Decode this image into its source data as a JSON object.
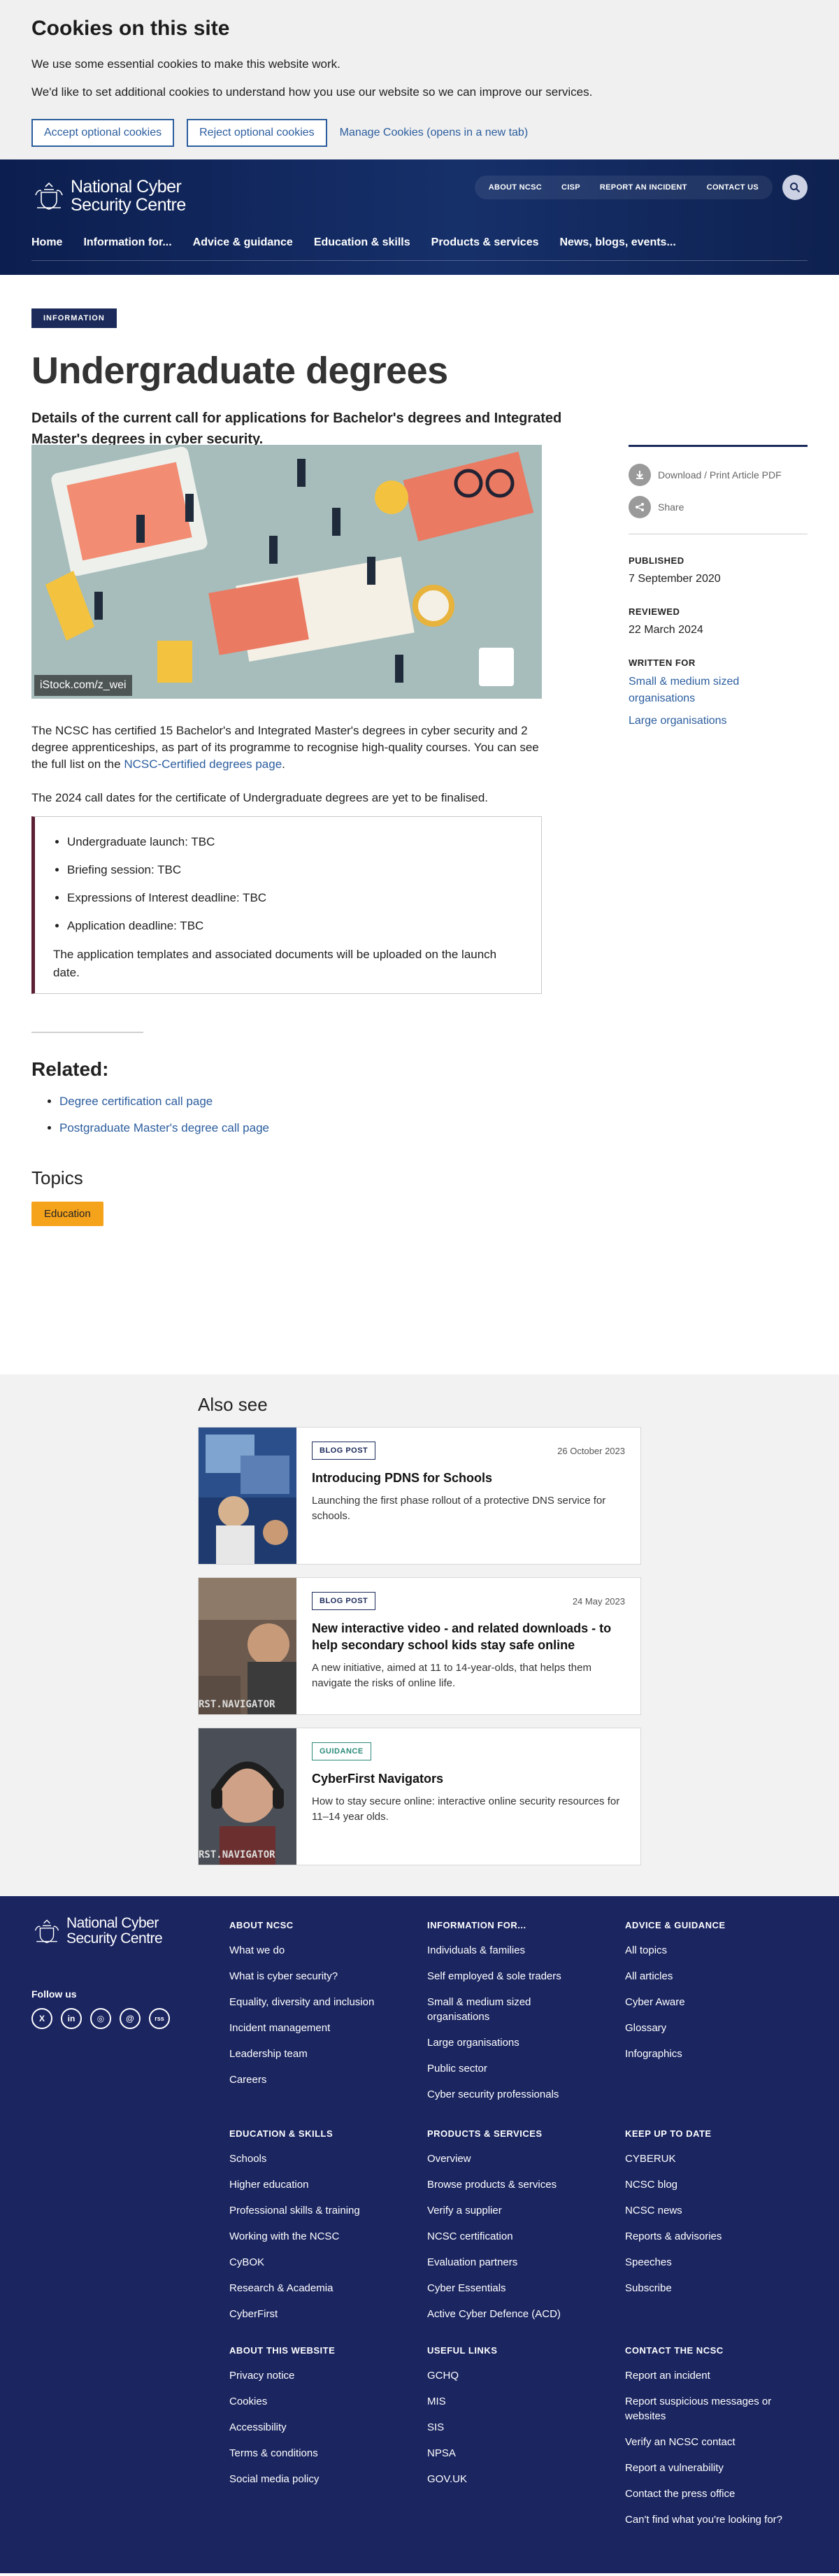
{
  "cookie": {
    "title": "Cookies on this site",
    "line1": "We use some essential cookies to make this website work.",
    "line2": "We'd like to set additional cookies to understand how you use our website so we can improve our services.",
    "accept": "Accept optional cookies",
    "reject": "Reject optional cookies",
    "manage": "Manage Cookies (opens in a new tab)"
  },
  "header": {
    "logo_line1": "National Cyber",
    "logo_line2": "Security Centre",
    "util": [
      "ABOUT NCSC",
      "CISP",
      "REPORT AN INCIDENT",
      "CONTACT US"
    ],
    "nav": [
      "Home",
      "Information for...",
      "Advice & guidance",
      "Education & skills",
      "Products & services",
      "News, blogs, events..."
    ]
  },
  "article": {
    "badge": "INFORMATION",
    "title": "Undergraduate degrees",
    "lede": "Details of the current call for applications for Bachelor's degrees and Integrated Master's degrees in cyber security.",
    "image_credit": "iStock.com/z_wei",
    "p1_before": "The NCSC has certified 15 Bachelor's and Integrated Master's degrees in cyber security and 2 degree apprenticeships, as part of its programme to recognise high-quality courses. You can see the full list on the ",
    "p1_link": "NCSC-Certified degrees page",
    "p1_after": ".",
    "p2": "The 2024 call dates for the certificate of Undergraduate degrees are yet to be finalised.",
    "callout_items": [
      "Undergraduate launch: TBC",
      "Briefing session: TBC",
      "Expressions of Interest deadline: TBC",
      "Application deadline: TBC"
    ],
    "callout_note": "The application templates and associated documents will be uploaded on the launch date.",
    "related_title": "Related:",
    "related_links": [
      "Degree certification call page",
      "Postgraduate Master's degree call page"
    ],
    "topics_title": "Topics",
    "topic_tag": "Education"
  },
  "sidebar": {
    "download": "Download / Print Article PDF",
    "share": "Share",
    "published_label": "PUBLISHED",
    "published": "7 September 2020",
    "reviewed_label": "REVIEWED",
    "reviewed": "22 March 2024",
    "written_label": "WRITTEN FOR",
    "written": [
      "Small & medium sized organisations",
      "Large organisations"
    ]
  },
  "also_see": {
    "title": "Also see",
    "cards": [
      {
        "tag": "BLOG POST",
        "date": "26 October 2023",
        "title": "Introducing PDNS for Schools",
        "desc": "Launching the first phase rollout of a protective DNS service for schools.",
        "img_text": ""
      },
      {
        "tag": "BLOG POST",
        "date": "24 May 2023",
        "title": "New interactive video - and related downloads - to help secondary school kids stay safe online",
        "desc": "A new initiative, aimed at 11 to 14-year-olds, that helps them navigate the risks of online life.",
        "img_text": "RST.NAVIGATOR"
      },
      {
        "tag": "GUIDANCE",
        "date": "",
        "title": "CyberFirst Navigators",
        "desc": "How to stay secure online: interactive online security resources for 11–14 year olds.",
        "img_text": "RST.NAVIGATOR"
      }
    ]
  },
  "footer": {
    "logo_line1": "National Cyber",
    "logo_line2": "Security Centre",
    "follow": "Follow us",
    "socials": [
      "X",
      "in",
      "◎",
      "@",
      "rss"
    ],
    "columns": [
      {
        "title": "ABOUT NCSC",
        "links": [
          "What we do",
          "What is cyber security?",
          "Equality, diversity and inclusion",
          "Incident management",
          "Leadership team",
          "Careers"
        ]
      },
      {
        "title": "INFORMATION FOR...",
        "links": [
          "Individuals & families",
          "Self employed & sole traders",
          "Small & medium sized organisations",
          "Large organisations",
          "Public sector",
          "Cyber security professionals"
        ]
      },
      {
        "title": "ADVICE & GUIDANCE",
        "links": [
          "All topics",
          "All articles",
          "Cyber Aware",
          "Glossary",
          "Infographics"
        ]
      },
      {
        "title": "EDUCATION & SKILLS",
        "links": [
          "Schools",
          "Higher education",
          "Professional skills & training",
          "Working with the NCSC",
          "CyBOK",
          "Research & Academia",
          "CyberFirst"
        ]
      },
      {
        "title": "PRODUCTS & SERVICES",
        "links": [
          "Overview",
          "Browse products & services",
          "Verify a supplier",
          "NCSC certification",
          "Evaluation partners",
          "Cyber Essentials",
          "Active Cyber Defence (ACD)"
        ]
      },
      {
        "title": "KEEP UP TO DATE",
        "links": [
          "CYBERUK",
          "NCSC blog",
          "NCSC news",
          "Reports & advisories",
          "Speeches",
          "Subscribe"
        ]
      },
      {
        "title": "ABOUT THIS WEBSITE",
        "links": [
          "Privacy notice",
          "Cookies",
          "Accessibility",
          "Terms & conditions",
          "Social media policy"
        ]
      },
      {
        "title": "USEFUL LINKS",
        "links": [
          "GCHQ",
          "MIS",
          "SIS",
          "NPSA",
          "GOV.UK"
        ]
      },
      {
        "title": "CONTACT THE NCSC",
        "links": [
          "Report an incident",
          "Report suspicious messages or websites",
          "Verify an NCSC contact",
          "Report a vulnerability",
          "Contact the press office",
          "Can't find what you're looking for?"
        ]
      }
    ]
  }
}
